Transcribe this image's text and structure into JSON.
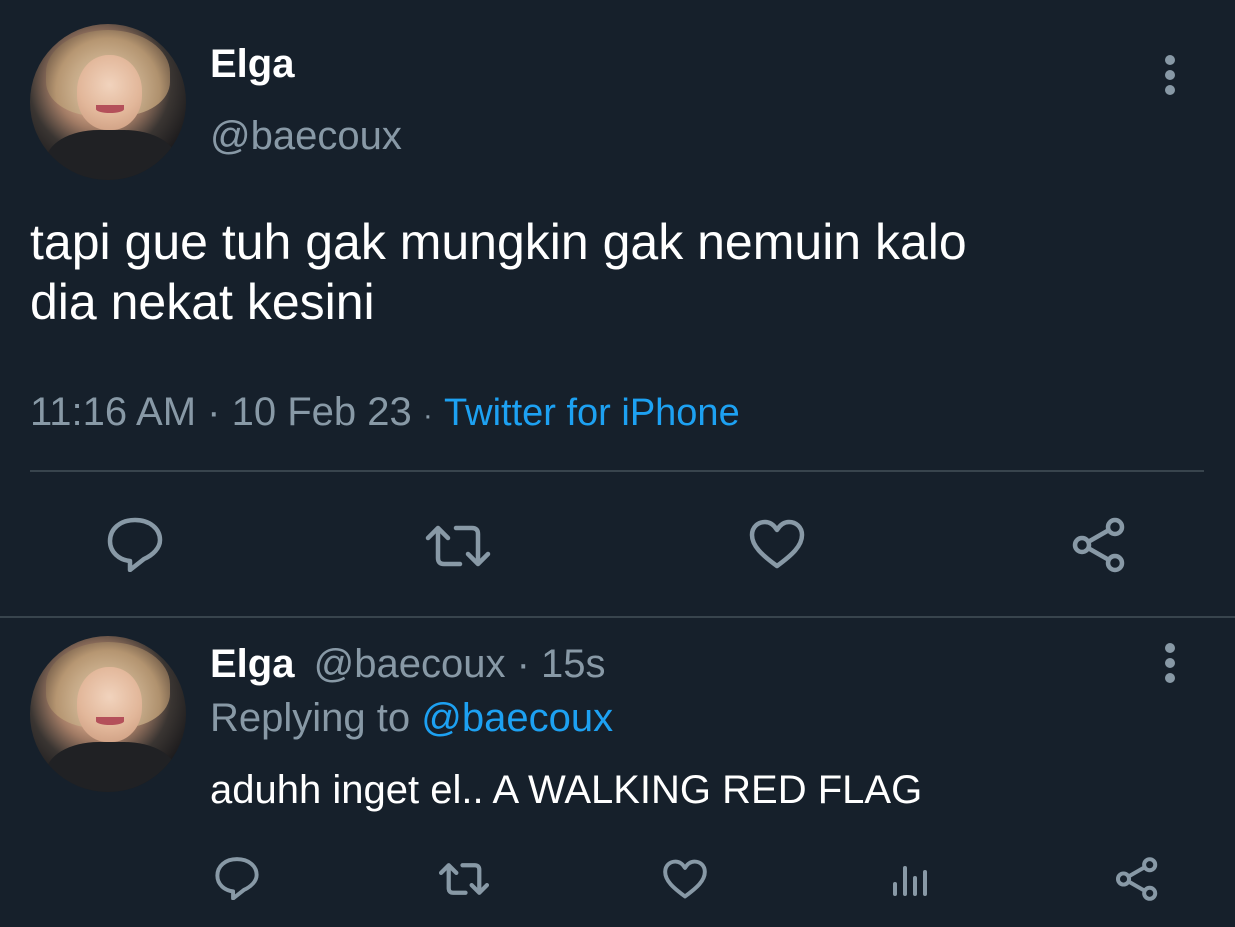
{
  "main_tweet": {
    "author_name": "Elga",
    "author_handle": "@baecoux",
    "text_line1": "tapi gue tuh gak mungkin gak nemuin kalo",
    "text_line2": "dia nekat kesini",
    "time": "11:16 AM",
    "separator1": "·",
    "date": "10 Feb 23",
    "separator2": "·",
    "source": "Twitter for iPhone"
  },
  "reply_tweet": {
    "author_name": "Elga",
    "author_handle": "@baecoux",
    "separator": "·",
    "age": "15s",
    "replying_label": "Replying to",
    "replying_handle": "@baecoux",
    "text": "aduhh inget el.. A WALKING RED FLAG"
  },
  "theme": {
    "background": "#16202b",
    "text": "#ffffff",
    "muted": "#8899a6",
    "link": "#1da1f2",
    "divider": "#38444d"
  },
  "icons": {
    "more": "more-vertical-icon",
    "reply": "reply-icon",
    "retweet": "retweet-icon",
    "like": "heart-icon",
    "share": "share-icon",
    "analytics": "analytics-icon"
  }
}
